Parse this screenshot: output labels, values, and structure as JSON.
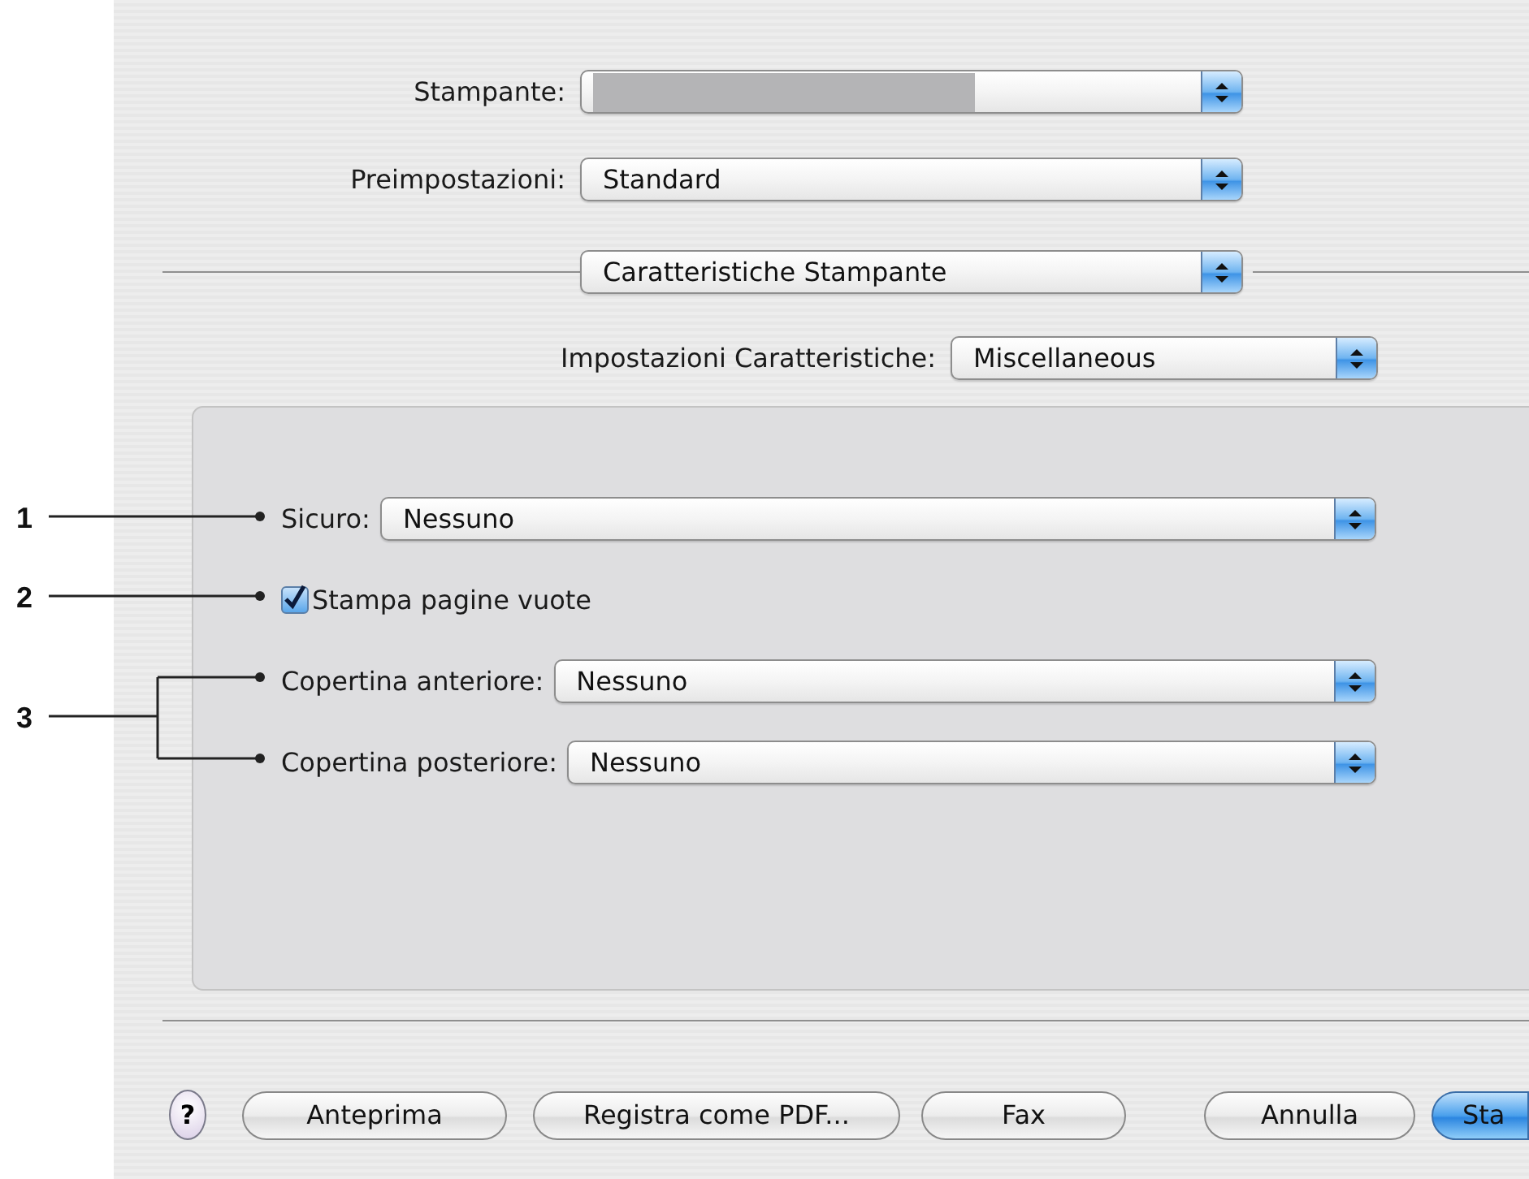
{
  "printer": {
    "label": "Stampante:",
    "value_redacted": true
  },
  "presets": {
    "label": "Preimpostazioni:",
    "value": "Standard"
  },
  "pane_menu": {
    "value": "Caratteristiche Stampante"
  },
  "feature_set": {
    "label": "Impostazioni Caratteristiche:",
    "value": "Miscellaneous"
  },
  "options": [
    {
      "kind": "popup",
      "label": "Sicuro:",
      "value": "Nessuno"
    },
    {
      "kind": "checkbox",
      "label": "Stampa pagine vuote",
      "checked": true
    },
    {
      "kind": "popup",
      "label": "Copertina anteriore:",
      "value": "Nessuno"
    },
    {
      "kind": "popup",
      "label": "Copertina posteriore:",
      "value": "Nessuno"
    }
  ],
  "help_button": "?",
  "buttons": [
    {
      "label": "Anteprima",
      "default": false
    },
    {
      "label": "Registra come PDF...",
      "default": false
    },
    {
      "label": "Fax",
      "default": false
    },
    {
      "label": "Annulla",
      "default": false
    },
    {
      "label": "Sta",
      "default": true
    }
  ],
  "callouts": [
    {
      "label": "1"
    },
    {
      "label": "2"
    },
    {
      "label": "3"
    }
  ]
}
